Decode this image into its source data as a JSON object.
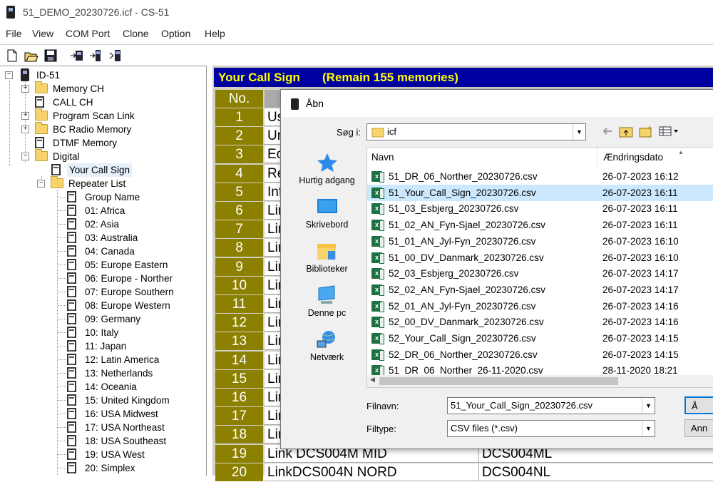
{
  "window": {
    "title": "51_DEMO_20230726.icf - CS-51"
  },
  "menu": [
    "File",
    "View",
    "COM Port",
    "Clone",
    "Option",
    "Help"
  ],
  "toolbar": {
    "icons": [
      "new-file-icon",
      "open-folder-icon",
      "save-icon",
      "read-from-radio-icon",
      "write-to-radio-icon",
      "clone-radio-icon"
    ]
  },
  "tree": {
    "root": "ID-51",
    "items": [
      "Memory CH",
      "CALL CH",
      "Program Scan Link",
      "BC Radio Memory",
      "DTMF Memory",
      "Digital",
      "Your Call Sign",
      "Repeater List",
      "Group Name",
      "01: Africa",
      "02: Asia",
      "03: Australia",
      "04: Canada",
      "05: Europe Eastern",
      "06: Europe - Norther",
      "07: Europe Southern",
      "08: Europe Western",
      "09: Germany",
      "10: Italy",
      "11: Japan",
      "12: Latin America",
      "13: Netherlands",
      "14: Oceania",
      "15: United Kingdom",
      "16: USA Midwest",
      "17: USA Northeast",
      "18: USA Southeast",
      "19: USA West",
      "20: Simplex"
    ]
  },
  "main": {
    "header_title": "Your Call Sign",
    "header_remaining": "(Remain 155 memories)",
    "col_no": "No.",
    "rows": [
      {
        "no": "1",
        "a": "Us",
        "b": ""
      },
      {
        "no": "2",
        "a": "Ur",
        "b": ""
      },
      {
        "no": "3",
        "a": "Ec",
        "b": ""
      },
      {
        "no": "4",
        "a": "Re",
        "b": ""
      },
      {
        "no": "5",
        "a": "Inf",
        "b": ""
      },
      {
        "no": "6",
        "a": "Lin",
        "b": ""
      },
      {
        "no": "7",
        "a": "Lin",
        "b": ""
      },
      {
        "no": "8",
        "a": "Lin",
        "b": ""
      },
      {
        "no": "9",
        "a": "Lin",
        "b": ""
      },
      {
        "no": "10",
        "a": "Lin",
        "b": ""
      },
      {
        "no": "11",
        "a": "Lin",
        "b": ""
      },
      {
        "no": "12",
        "a": "Lin",
        "b": ""
      },
      {
        "no": "13",
        "a": "Lin",
        "b": ""
      },
      {
        "no": "14",
        "a": "Lin",
        "b": ""
      },
      {
        "no": "15",
        "a": "Lin",
        "b": ""
      },
      {
        "no": "16",
        "a": "Lin",
        "b": ""
      },
      {
        "no": "17",
        "a": "Lin",
        "b": ""
      },
      {
        "no": "18",
        "a": "Lin",
        "b": ""
      },
      {
        "no": "19",
        "a": "Link DCS004M MID",
        "b": "DCS004ML"
      },
      {
        "no": "20",
        "a": "LinkDCS004N NORD",
        "b": "DCS004NL"
      }
    ]
  },
  "dialog": {
    "title": "Åbn",
    "look_in_label": "Søg i:",
    "look_in_value": "icf",
    "places": [
      "Hurtig adgang",
      "Skrivebord",
      "Biblioteker",
      "Denne pc",
      "Netværk"
    ],
    "col_name": "Navn",
    "col_date": "Ændringsdato",
    "files": [
      {
        "name": "51_DR_06_Norther_20230726.csv",
        "date": "26-07-2023 16:12"
      },
      {
        "name": "51_Your_Call_Sign_20230726.csv",
        "date": "26-07-2023 16:11"
      },
      {
        "name": "51_03_Esbjerg_20230726.csv",
        "date": "26-07-2023 16:11"
      },
      {
        "name": "51_02_AN_Fyn-Sjael_20230726.csv",
        "date": "26-07-2023 16:11"
      },
      {
        "name": "51_01_AN_Jyl-Fyn_20230726.csv",
        "date": "26-07-2023 16:10"
      },
      {
        "name": "51_00_DV_Danmark_20230726.csv",
        "date": "26-07-2023 16:10"
      },
      {
        "name": "52_03_Esbjerg_20230726.csv",
        "date": "26-07-2023 14:17"
      },
      {
        "name": "52_02_AN_Fyn-Sjael_20230726.csv",
        "date": "26-07-2023 14:17"
      },
      {
        "name": "52_01_AN_Jyl-Fyn_20230726.csv",
        "date": "26-07-2023 14:16"
      },
      {
        "name": "52_00_DV_Danmark_20230726.csv",
        "date": "26-07-2023 14:16"
      },
      {
        "name": "52_Your_Call_Sign_20230726.csv",
        "date": "26-07-2023 14:15"
      },
      {
        "name": "52_DR_06_Norther_20230726.csv",
        "date": "26-07-2023 14:15"
      },
      {
        "name": "51_DR_06_Norther_26-11-2020.csv",
        "date": "28-11-2020 18:21"
      }
    ],
    "selected_file_index": 1,
    "filename_label": "Filnavn:",
    "filename_value": "51_Your_Call_Sign_20230726.csv",
    "filetype_label": "Filtype:",
    "filetype_value": "CSV files (*.csv)",
    "open_button": "Å",
    "cancel_button": "Ann"
  },
  "colors": {
    "header_bg": "#0000a0",
    "header_text": "#ffff00",
    "row_number_bg": "#8b8000",
    "selected_row": "#cce8ff"
  }
}
